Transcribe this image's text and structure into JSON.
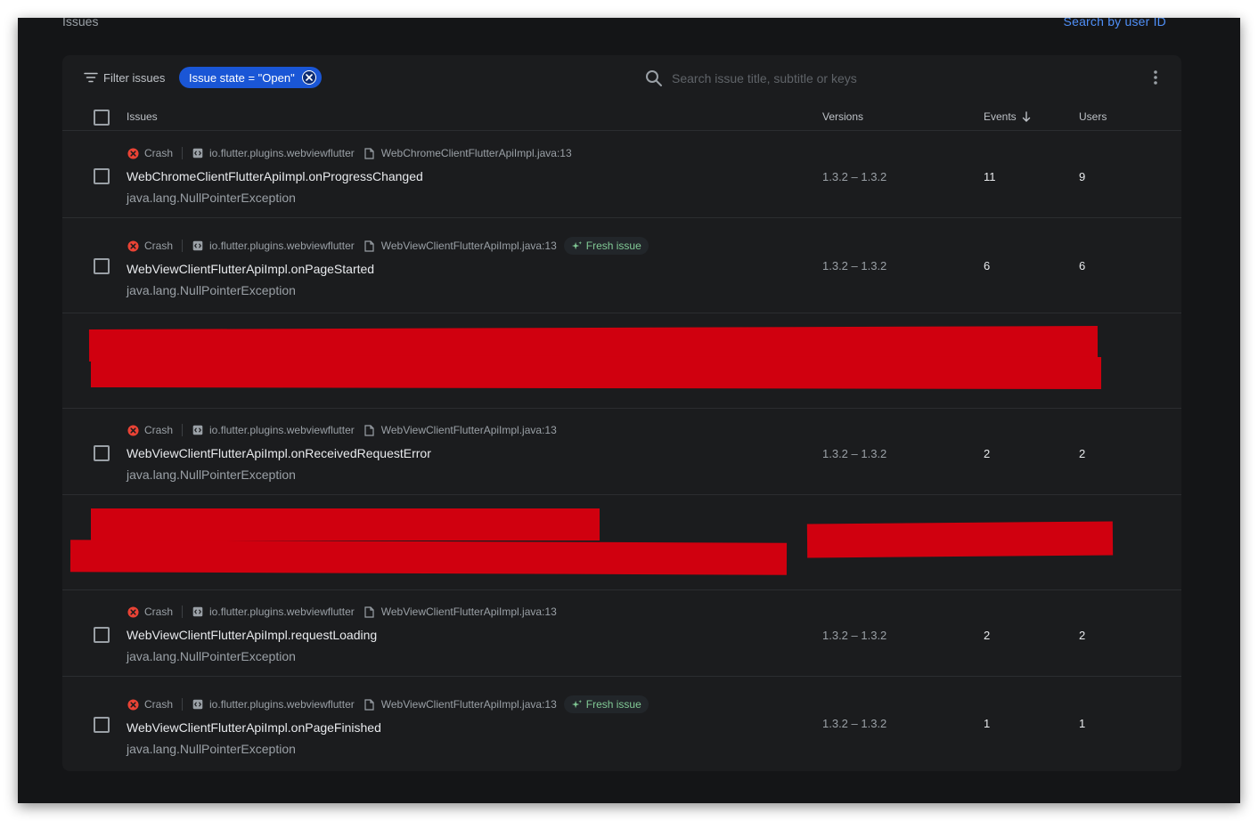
{
  "page": {
    "title": "Issues",
    "search_user_link": "Search by user ID"
  },
  "toolbar": {
    "filter_label": "Filter issues",
    "chip_label": "Issue state = \"Open\"",
    "search_placeholder": "Search issue title, subtitle or keys"
  },
  "columns": {
    "issues": "Issues",
    "versions": "Versions",
    "events": "Events",
    "users": "Users"
  },
  "colors": {
    "accent": "#1a56d6",
    "link": "#4f8ff7",
    "crash": "#ea4335",
    "fresh": "#81c995",
    "redaction": "#d0000f"
  },
  "issues": [
    {
      "type": "Crash",
      "package": "io.flutter.plugins.webviewflutter",
      "file": "WebChromeClientFlutterApiImpl.java:13",
      "fresh": "",
      "title": "WebChromeClientFlutterApiImpl.onProgressChanged",
      "subtitle": "java.lang.NullPointerException",
      "versions": "1.3.2 – 1.3.2",
      "events": "11",
      "users": "9"
    },
    {
      "type": "Crash",
      "package": "io.flutter.plugins.webviewflutter",
      "file": "WebViewClientFlutterApiImpl.java:13",
      "fresh": "Fresh issue",
      "title": "WebViewClientFlutterApiImpl.onPageStarted",
      "subtitle": "java.lang.NullPointerException",
      "versions": "1.3.2 – 1.3.2",
      "events": "6",
      "users": "6"
    },
    {
      "type": "Crash",
      "package": "io.flutter.plugins.webviewflutter",
      "file": "WebViewClientFlutterApiImpl.java:13",
      "fresh": "",
      "title": "WebViewClientFlutterApiImpl.onReceivedRequestError",
      "subtitle": "java.lang.NullPointerException",
      "versions": "1.3.2 – 1.3.2",
      "events": "2",
      "users": "2"
    },
    {
      "type": "Crash",
      "package": "io.flutter.plugins.webviewflutter",
      "file": "WebViewClientFlutterApiImpl.java:13",
      "fresh": "",
      "title": "WebViewClientFlutterApiImpl.requestLoading",
      "subtitle": "java.lang.NullPointerException",
      "versions": "1.3.2 – 1.3.2",
      "events": "2",
      "users": "2"
    },
    {
      "type": "Crash",
      "package": "io.flutter.plugins.webviewflutter",
      "file": "WebViewClientFlutterApiImpl.java:13",
      "fresh": "Fresh issue",
      "title": "WebViewClientFlutterApiImpl.onPageFinished",
      "subtitle": "java.lang.NullPointerException",
      "versions": "1.3.2 – 1.3.2",
      "events": "1",
      "users": "1"
    }
  ]
}
